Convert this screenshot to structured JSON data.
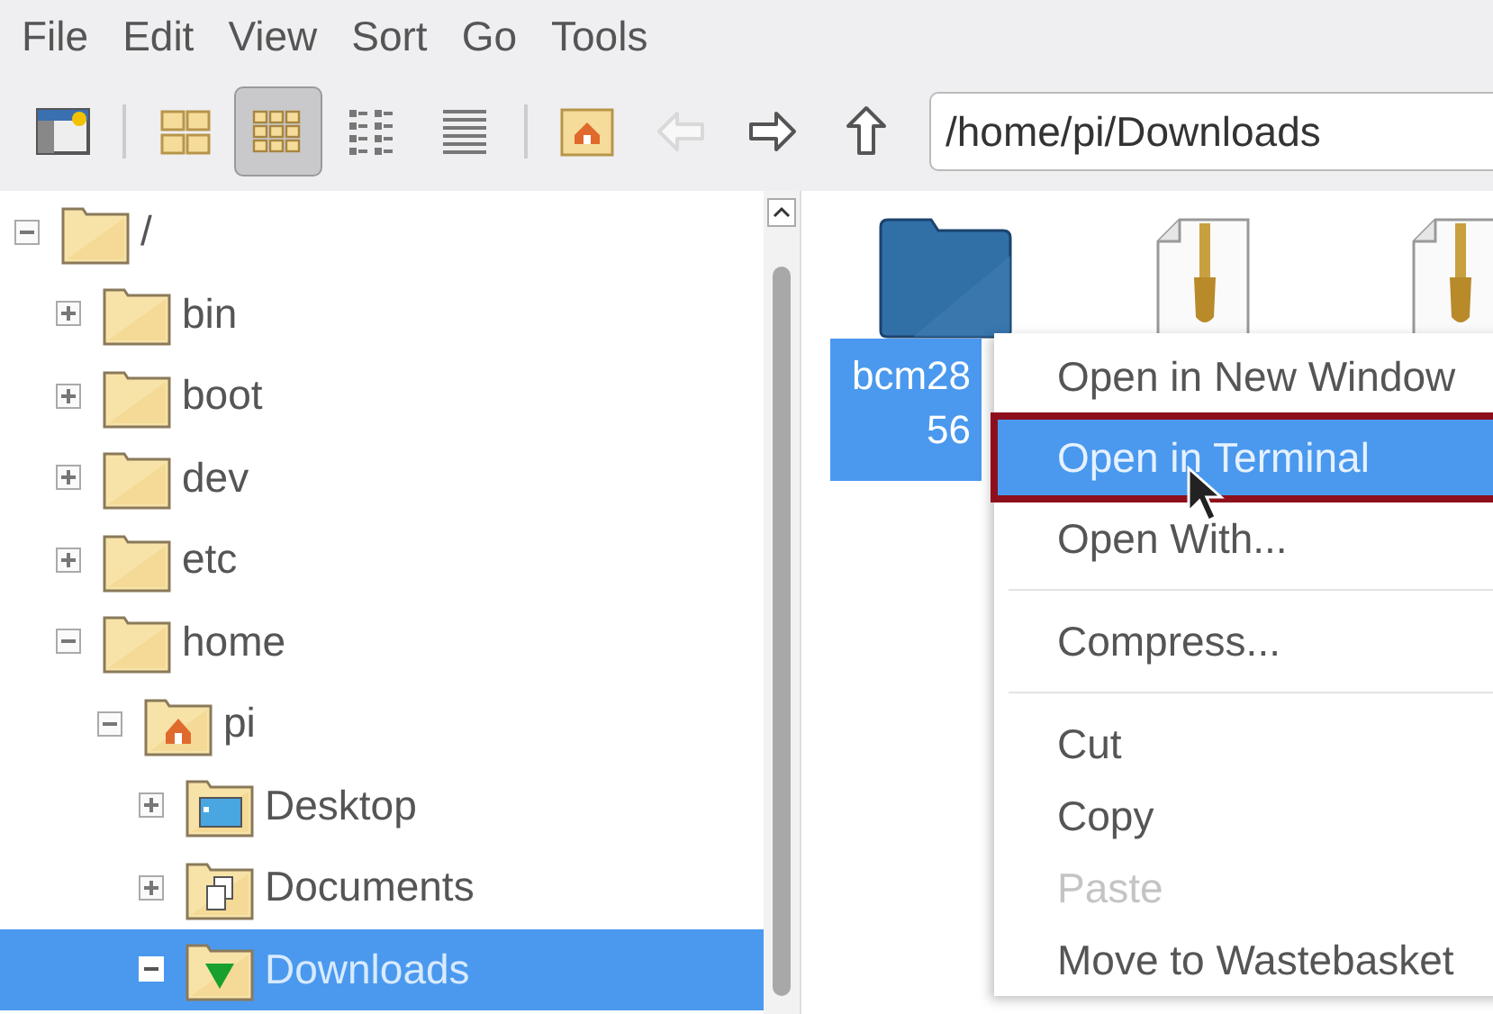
{
  "menubar": [
    "File",
    "Edit",
    "View",
    "Sort",
    "Go",
    "Tools"
  ],
  "toolbar": {
    "buttons": [
      {
        "kind": "new-window",
        "selected": false,
        "disabled": false
      },
      {
        "kind": "icons",
        "selected": false,
        "disabled": false
      },
      {
        "kind": "thumbnails",
        "selected": true,
        "disabled": false
      },
      {
        "kind": "compact",
        "selected": false,
        "disabled": false
      },
      {
        "kind": "list",
        "selected": false,
        "disabled": false
      },
      {
        "kind": "home",
        "selected": false,
        "disabled": false
      },
      {
        "kind": "back",
        "selected": false,
        "disabled": true
      },
      {
        "kind": "forward",
        "selected": false,
        "disabled": false
      },
      {
        "kind": "up",
        "selected": false,
        "disabled": false
      }
    ],
    "path": "/home/pi/Downloads"
  },
  "tree": [
    {
      "label": "/",
      "kind": "folder",
      "expanded": true,
      "selected": false,
      "children": [
        {
          "label": "bin",
          "kind": "folder",
          "expanded": false,
          "selected": false
        },
        {
          "label": "boot",
          "kind": "folder",
          "expanded": false,
          "selected": false
        },
        {
          "label": "dev",
          "kind": "folder",
          "expanded": false,
          "selected": false
        },
        {
          "label": "etc",
          "kind": "folder",
          "expanded": false,
          "selected": false
        },
        {
          "label": "home",
          "kind": "folder",
          "expanded": true,
          "selected": false,
          "children": [
            {
              "label": "pi",
              "kind": "home",
              "expanded": true,
              "selected": false,
              "children": [
                {
                  "label": "Desktop",
                  "kind": "desktop",
                  "expanded": false,
                  "selected": false
                },
                {
                  "label": "Documents",
                  "kind": "documents",
                  "expanded": false,
                  "selected": false
                },
                {
                  "label": "Downloads",
                  "kind": "downloads",
                  "expanded": true,
                  "selected": true
                }
              ]
            }
          ]
        }
      ]
    }
  ],
  "files": [
    {
      "kind": "folder",
      "selected": true,
      "label_lines": [
        "bcm28",
        "56"
      ]
    },
    {
      "kind": "archive",
      "selected": false
    },
    {
      "kind": "archive",
      "selected": false
    }
  ],
  "context_menu": [
    {
      "kind": "item",
      "label": "Open in New Window",
      "selected": false,
      "disabled": false,
      "outlined": false
    },
    {
      "kind": "item",
      "label": "Open in Terminal",
      "selected": true,
      "disabled": false,
      "outlined": true
    },
    {
      "kind": "item",
      "label": "Open With...",
      "selected": false,
      "disabled": false,
      "outlined": false
    },
    {
      "kind": "separator"
    },
    {
      "kind": "item",
      "label": "Compress...",
      "selected": false,
      "disabled": false,
      "outlined": false
    },
    {
      "kind": "separator"
    },
    {
      "kind": "item",
      "label": "Cut",
      "selected": false,
      "disabled": false,
      "outlined": false
    },
    {
      "kind": "item",
      "label": "Copy",
      "selected": false,
      "disabled": false,
      "outlined": false
    },
    {
      "kind": "item",
      "label": "Paste",
      "selected": false,
      "disabled": true,
      "outlined": false
    },
    {
      "kind": "item",
      "label": "Move to Wastebasket",
      "selected": false,
      "disabled": false,
      "outlined": false
    }
  ]
}
